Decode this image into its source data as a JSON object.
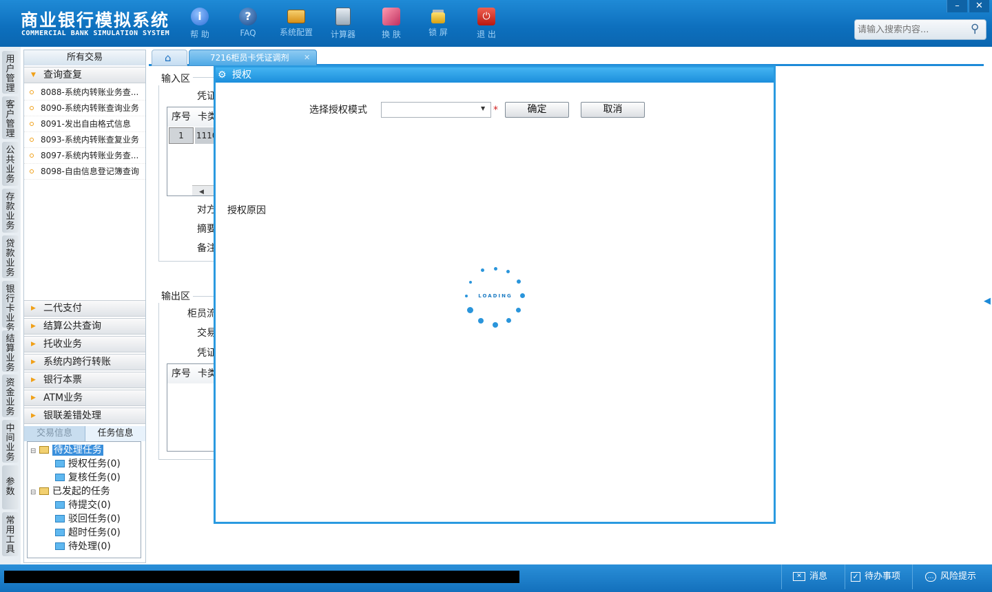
{
  "app": {
    "title": "商业银行模拟系统",
    "subtitle": "COMMERCIAL BANK SIMULATION SYSTEM"
  },
  "toolbar": [
    {
      "label": "帮 助",
      "icon": "info-icon",
      "color": "#2f6fd6"
    },
    {
      "label": "FAQ",
      "icon": "question-icon",
      "color": "#1a4a8a"
    },
    {
      "label": "系统配置",
      "icon": "toolbox-icon",
      "color": "#e0a020"
    },
    {
      "label": "计算器",
      "icon": "calculator-icon",
      "color": "#7a8a9a"
    },
    {
      "label": "换 肤",
      "icon": "shirt-icon",
      "color": "#e06080"
    },
    {
      "label": "锁 屏",
      "icon": "lock-icon",
      "color": "#f0c020"
    },
    {
      "label": "退 出",
      "icon": "power-icon",
      "color": "#d83020"
    }
  ],
  "window_controls": {
    "minimize": "–",
    "close": "✕"
  },
  "search": {
    "placeholder": "请输入搜索内容..."
  },
  "vertical_tabs": [
    "用户管理",
    "客户管理",
    "公共业务",
    "存款业务",
    "贷款业务",
    "银行卡业务",
    "结算业务",
    "资金业务",
    "中间业务",
    "参数",
    "常用工具"
  ],
  "left_panel": {
    "title": "所有交易",
    "active_group": "查询查复",
    "items": [
      "8088-系统内转账业务查...",
      "8090-系统内转账查询业务",
      "8091-发出自由格式信息",
      "8093-系统内转账查复业务",
      "8097-系统内转账业务查...",
      "8098-自由信息登记簿查询"
    ],
    "groups": [
      "二代支付",
      "结算公共查询",
      "托收业务",
      "系统内跨行转账",
      "银行本票",
      "ATM业务",
      "银联差错处理"
    ],
    "tabs": [
      "交易信息",
      "任务信息"
    ],
    "tree": {
      "pending": "待处理任务",
      "pending_children": [
        "授权任务(0)",
        "复核任务(0)"
      ],
      "initiated": "已发起的任务",
      "initiated_children": [
        "待提交(0)",
        "驳回任务(0)",
        "超时任务(0)",
        "待处理(0)"
      ]
    }
  },
  "tabs": {
    "active": "7216柜员卡凭证调剂"
  },
  "input_area": {
    "legend": "输入区",
    "voucher_label": "凭证",
    "grid_headers": [
      "序号",
      "卡类"
    ],
    "grid_row": {
      "index": "1",
      "value": "1110"
    },
    "labels": [
      "对方",
      "摘要",
      "备注"
    ]
  },
  "output_area": {
    "legend": "输出区",
    "labels": [
      "柜员流",
      "交易",
      "凭证"
    ],
    "grid_headers": [
      "序号",
      "卡类"
    ]
  },
  "dialog": {
    "title": "授权",
    "mode_label": "选择授权模式",
    "mode_value": "",
    "required_mark": "*",
    "confirm": "确定",
    "cancel": "取消",
    "reason_label": "授权原因",
    "loading_text": "LOADING"
  },
  "statusbar": {
    "messages": "消息",
    "todo": "待办事项",
    "risk": "风险提示"
  },
  "colors": {
    "header": "#0d6fbd",
    "accent": "#1d8ad8",
    "dialog_border": "#2a9ae0"
  }
}
